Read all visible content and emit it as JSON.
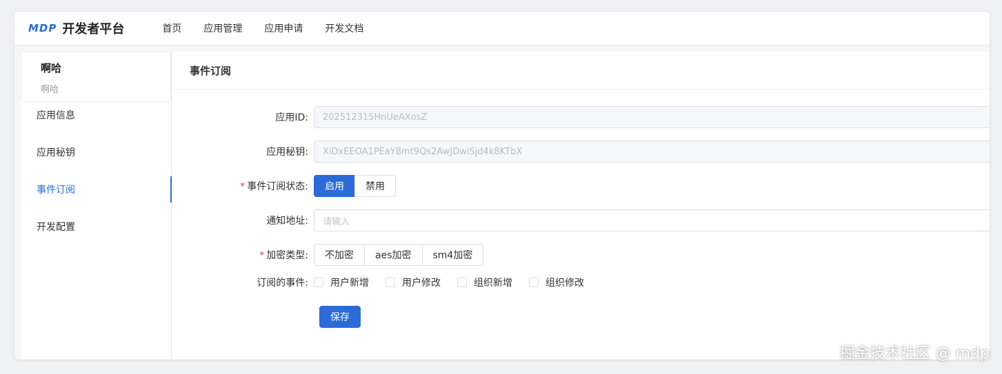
{
  "brand": {
    "mark": "MDP",
    "name": "开发者平台",
    "color": "#2b6bd8"
  },
  "nav": [
    {
      "label": "首页"
    },
    {
      "label": "应用管理"
    },
    {
      "label": "应用申请"
    },
    {
      "label": "开发文档"
    }
  ],
  "app": {
    "name": "啊哈",
    "subtitle": "啊哈"
  },
  "menu": [
    {
      "label": "应用信息"
    },
    {
      "label": "应用秘钥"
    },
    {
      "label": "事件订阅"
    },
    {
      "label": "开发配置"
    }
  ],
  "main": {
    "title": "事件订阅",
    "fields": {
      "app_id": {
        "label": "应用ID",
        "value": "202512315HnUeAXosZ"
      },
      "app_secret": {
        "label": "应用秘钥",
        "value": "XiDxEEOA1PEaY8mt9Qs2AwJDwiSjd4k8KTbX"
      },
      "status": {
        "label": "事件订阅状态",
        "options": [
          "启用",
          "禁用"
        ],
        "selected": "启用"
      },
      "notify_url": {
        "label": "通知地址",
        "placeholder": "请输入"
      },
      "encrypt": {
        "label": "加密类型",
        "options": [
          "不加密",
          "aes加密",
          "sm4加密"
        ]
      },
      "events": {
        "label": "订阅的事件",
        "options": [
          "用户新增",
          "用户修改",
          "组织新增",
          "组织修改"
        ]
      }
    },
    "save_label": "保存"
  },
  "label_suffix": ":",
  "watermark": "掘金技术社区 @ mdp"
}
